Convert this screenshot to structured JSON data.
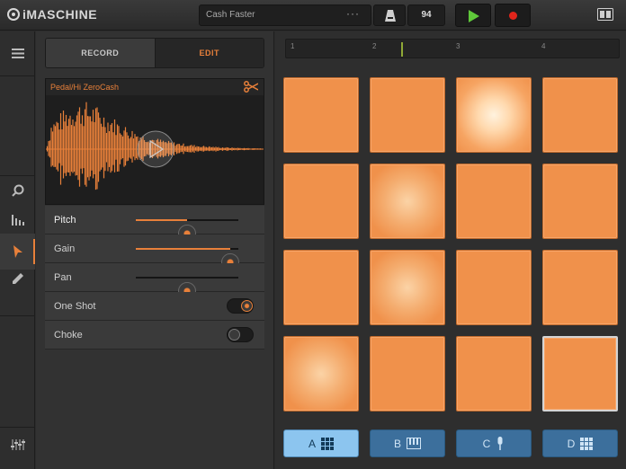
{
  "app": {
    "title": "iMASCHINE"
  },
  "transport": {
    "song_name": "Cash Faster",
    "more": "···",
    "tempo": "94",
    "play_color": "#5fc83a",
    "record_color": "#e0251b"
  },
  "panel": {
    "tabs": [
      {
        "label": "RECORD",
        "active": false
      },
      {
        "label": "EDIT",
        "active": true
      }
    ],
    "sample_name": "Pedal/Hi ZeroCash",
    "rows": [
      {
        "label": "Pitch",
        "type": "slider",
        "value": 0.5
      },
      {
        "label": "Gain",
        "type": "slider",
        "value": 0.92
      },
      {
        "label": "Pan",
        "type": "slider",
        "value": 0.5
      },
      {
        "label": "One Shot",
        "type": "toggle",
        "on": true
      },
      {
        "label": "Choke",
        "type": "toggle",
        "on": false
      }
    ]
  },
  "timeline": {
    "bars": [
      "1",
      "2",
      "3",
      "4"
    ]
  },
  "pads": {
    "count": 16,
    "lit": [
      2,
      5,
      9,
      12
    ],
    "selected": 15
  },
  "banks": [
    {
      "label": "A",
      "icon": "grid-icon",
      "active": true
    },
    {
      "label": "B",
      "icon": "keyboard-icon",
      "active": false
    },
    {
      "label": "C",
      "icon": "mic-icon",
      "active": false
    },
    {
      "label": "D",
      "icon": "grid-icon",
      "active": false
    }
  ],
  "colors": {
    "accent": "#e8803a",
    "pad": "#f0914b",
    "bank": "#3c6f9c",
    "bank_active": "#8cc5ef"
  }
}
